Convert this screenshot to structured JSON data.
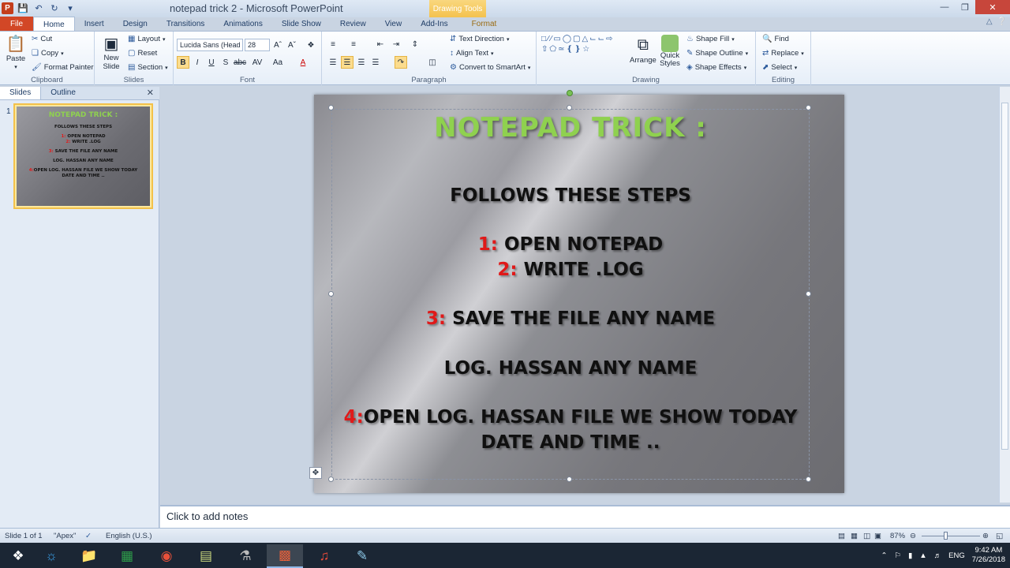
{
  "window": {
    "title": "notepad trick 2  -  Microsoft PowerPoint",
    "context_tab_header": "Drawing Tools",
    "app_icon_letter": "P"
  },
  "tabs": [
    "File",
    "Home",
    "Insert",
    "Design",
    "Transitions",
    "Animations",
    "Slide Show",
    "Review",
    "View",
    "Add-Ins",
    "Format"
  ],
  "ribbon": {
    "clipboard": {
      "label": "Clipboard",
      "paste": "Paste",
      "cut": "Cut",
      "copy": "Copy",
      "format_painter": "Format Painter"
    },
    "slides": {
      "label": "Slides",
      "new_slide": "New Slide",
      "layout": "Layout",
      "reset": "Reset",
      "section": "Section"
    },
    "font": {
      "label": "Font",
      "font_name": "Lucida Sans (Head",
      "font_size": "28"
    },
    "paragraph": {
      "label": "Paragraph",
      "text_direction": "Text Direction",
      "align_text": "Align Text",
      "convert_smartart": "Convert to SmartArt"
    },
    "drawing": {
      "label": "Drawing",
      "arrange": "Arrange",
      "quick_styles": "Quick Styles",
      "shape_fill": "Shape Fill",
      "shape_outline": "Shape Outline",
      "shape_effects": "Shape Effects"
    },
    "editing": {
      "label": "Editing",
      "find": "Find",
      "replace": "Replace",
      "select": "Select"
    }
  },
  "left_panel": {
    "tabs": [
      "Slides",
      "Outline"
    ],
    "slide_number": "1"
  },
  "slide": {
    "title": "NOTEPAD TRICK :",
    "heading": "FOLLOWS THESE STEPS",
    "step1_num": "1:",
    "step1_text": " OPEN NOTEPAD",
    "step2_num": "2:",
    "step2_text": " WRITE  .LOG",
    "step3_num": "3:",
    "step3_text": " SAVE THE FILE ANY NAME",
    "line_log": "LOG. HASSAN  ANY NAME",
    "step4_num": "4:",
    "step4_text": "OPEN LOG. HASSAN FILE WE SHOW TODAY",
    "step4_text2": "DATE AND TIME .."
  },
  "notes": {
    "placeholder": "Click to add notes"
  },
  "statusbar": {
    "slide_info": "Slide 1 of 1",
    "theme": "\"Apex\"",
    "language": "English (U.S.)",
    "zoom": "87%"
  },
  "taskbar": {
    "language": "ENG",
    "time": "9:42 AM",
    "date": "7/26/2018"
  },
  "colors": {
    "title_green": "#8fd14f",
    "step_red": "#e01919",
    "file_tab": "#d24726"
  }
}
